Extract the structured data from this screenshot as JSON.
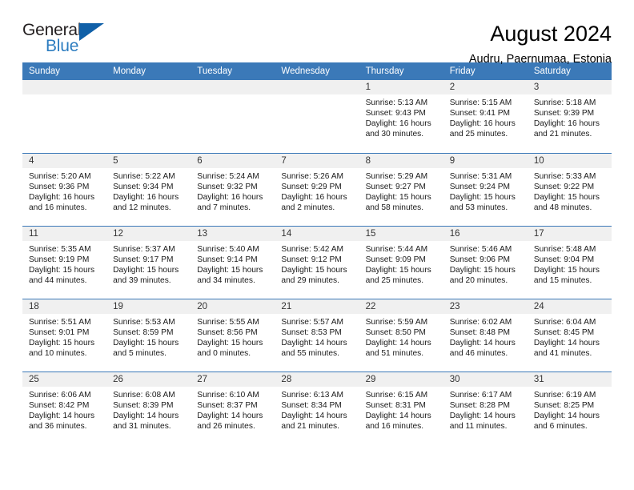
{
  "brand": {
    "line1": "General",
    "line2": "Blue",
    "triangle_icon": "brand-triangle-icon",
    "accent_color": "#1060a8",
    "blue_text_color": "#2d7dc0"
  },
  "header": {
    "title": "August 2024",
    "subtitle": "Audru, Paernumaa, Estonia"
  },
  "theme": {
    "header_row_bg": "#3b79b8",
    "daynum_bg": "#f0f0f0",
    "row_separator": "#3b79b8"
  },
  "calendar": {
    "weekday_headers": [
      "Sunday",
      "Monday",
      "Tuesday",
      "Wednesday",
      "Thursday",
      "Friday",
      "Saturday"
    ],
    "weeks": [
      [
        {
          "day": "",
          "lines": []
        },
        {
          "day": "",
          "lines": []
        },
        {
          "day": "",
          "lines": []
        },
        {
          "day": "",
          "lines": []
        },
        {
          "day": "1",
          "lines": [
            "Sunrise: 5:13 AM",
            "Sunset: 9:43 PM",
            "Daylight: 16 hours",
            "and 30 minutes."
          ]
        },
        {
          "day": "2",
          "lines": [
            "Sunrise: 5:15 AM",
            "Sunset: 9:41 PM",
            "Daylight: 16 hours",
            "and 25 minutes."
          ]
        },
        {
          "day": "3",
          "lines": [
            "Sunrise: 5:18 AM",
            "Sunset: 9:39 PM",
            "Daylight: 16 hours",
            "and 21 minutes."
          ]
        }
      ],
      [
        {
          "day": "4",
          "lines": [
            "Sunrise: 5:20 AM",
            "Sunset: 9:36 PM",
            "Daylight: 16 hours",
            "and 16 minutes."
          ]
        },
        {
          "day": "5",
          "lines": [
            "Sunrise: 5:22 AM",
            "Sunset: 9:34 PM",
            "Daylight: 16 hours",
            "and 12 minutes."
          ]
        },
        {
          "day": "6",
          "lines": [
            "Sunrise: 5:24 AM",
            "Sunset: 9:32 PM",
            "Daylight: 16 hours",
            "and 7 minutes."
          ]
        },
        {
          "day": "7",
          "lines": [
            "Sunrise: 5:26 AM",
            "Sunset: 9:29 PM",
            "Daylight: 16 hours",
            "and 2 minutes."
          ]
        },
        {
          "day": "8",
          "lines": [
            "Sunrise: 5:29 AM",
            "Sunset: 9:27 PM",
            "Daylight: 15 hours",
            "and 58 minutes."
          ]
        },
        {
          "day": "9",
          "lines": [
            "Sunrise: 5:31 AM",
            "Sunset: 9:24 PM",
            "Daylight: 15 hours",
            "and 53 minutes."
          ]
        },
        {
          "day": "10",
          "lines": [
            "Sunrise: 5:33 AM",
            "Sunset: 9:22 PM",
            "Daylight: 15 hours",
            "and 48 minutes."
          ]
        }
      ],
      [
        {
          "day": "11",
          "lines": [
            "Sunrise: 5:35 AM",
            "Sunset: 9:19 PM",
            "Daylight: 15 hours",
            "and 44 minutes."
          ]
        },
        {
          "day": "12",
          "lines": [
            "Sunrise: 5:37 AM",
            "Sunset: 9:17 PM",
            "Daylight: 15 hours",
            "and 39 minutes."
          ]
        },
        {
          "day": "13",
          "lines": [
            "Sunrise: 5:40 AM",
            "Sunset: 9:14 PM",
            "Daylight: 15 hours",
            "and 34 minutes."
          ]
        },
        {
          "day": "14",
          "lines": [
            "Sunrise: 5:42 AM",
            "Sunset: 9:12 PM",
            "Daylight: 15 hours",
            "and 29 minutes."
          ]
        },
        {
          "day": "15",
          "lines": [
            "Sunrise: 5:44 AM",
            "Sunset: 9:09 PM",
            "Daylight: 15 hours",
            "and 25 minutes."
          ]
        },
        {
          "day": "16",
          "lines": [
            "Sunrise: 5:46 AM",
            "Sunset: 9:06 PM",
            "Daylight: 15 hours",
            "and 20 minutes."
          ]
        },
        {
          "day": "17",
          "lines": [
            "Sunrise: 5:48 AM",
            "Sunset: 9:04 PM",
            "Daylight: 15 hours",
            "and 15 minutes."
          ]
        }
      ],
      [
        {
          "day": "18",
          "lines": [
            "Sunrise: 5:51 AM",
            "Sunset: 9:01 PM",
            "Daylight: 15 hours",
            "and 10 minutes."
          ]
        },
        {
          "day": "19",
          "lines": [
            "Sunrise: 5:53 AM",
            "Sunset: 8:59 PM",
            "Daylight: 15 hours",
            "and 5 minutes."
          ]
        },
        {
          "day": "20",
          "lines": [
            "Sunrise: 5:55 AM",
            "Sunset: 8:56 PM",
            "Daylight: 15 hours",
            "and 0 minutes."
          ]
        },
        {
          "day": "21",
          "lines": [
            "Sunrise: 5:57 AM",
            "Sunset: 8:53 PM",
            "Daylight: 14 hours",
            "and 55 minutes."
          ]
        },
        {
          "day": "22",
          "lines": [
            "Sunrise: 5:59 AM",
            "Sunset: 8:50 PM",
            "Daylight: 14 hours",
            "and 51 minutes."
          ]
        },
        {
          "day": "23",
          "lines": [
            "Sunrise: 6:02 AM",
            "Sunset: 8:48 PM",
            "Daylight: 14 hours",
            "and 46 minutes."
          ]
        },
        {
          "day": "24",
          "lines": [
            "Sunrise: 6:04 AM",
            "Sunset: 8:45 PM",
            "Daylight: 14 hours",
            "and 41 minutes."
          ]
        }
      ],
      [
        {
          "day": "25",
          "lines": [
            "Sunrise: 6:06 AM",
            "Sunset: 8:42 PM",
            "Daylight: 14 hours",
            "and 36 minutes."
          ]
        },
        {
          "day": "26",
          "lines": [
            "Sunrise: 6:08 AM",
            "Sunset: 8:39 PM",
            "Daylight: 14 hours",
            "and 31 minutes."
          ]
        },
        {
          "day": "27",
          "lines": [
            "Sunrise: 6:10 AM",
            "Sunset: 8:37 PM",
            "Daylight: 14 hours",
            "and 26 minutes."
          ]
        },
        {
          "day": "28",
          "lines": [
            "Sunrise: 6:13 AM",
            "Sunset: 8:34 PM",
            "Daylight: 14 hours",
            "and 21 minutes."
          ]
        },
        {
          "day": "29",
          "lines": [
            "Sunrise: 6:15 AM",
            "Sunset: 8:31 PM",
            "Daylight: 14 hours",
            "and 16 minutes."
          ]
        },
        {
          "day": "30",
          "lines": [
            "Sunrise: 6:17 AM",
            "Sunset: 8:28 PM",
            "Daylight: 14 hours",
            "and 11 minutes."
          ]
        },
        {
          "day": "31",
          "lines": [
            "Sunrise: 6:19 AM",
            "Sunset: 8:25 PM",
            "Daylight: 14 hours",
            "and 6 minutes."
          ]
        }
      ]
    ]
  }
}
